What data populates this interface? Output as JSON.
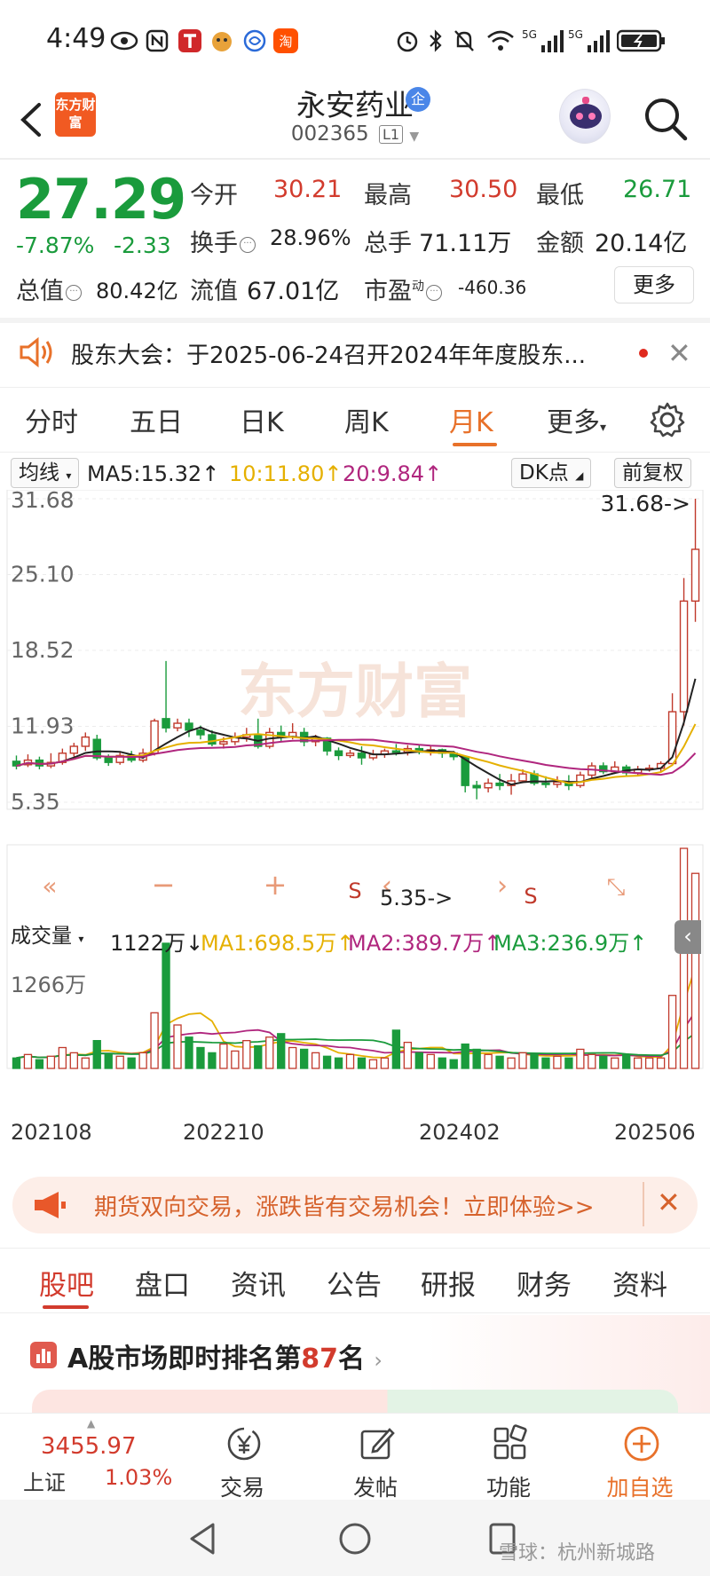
{
  "status_bar": {
    "time": "4:49",
    "network_badges": [
      "5G",
      "5G"
    ]
  },
  "header": {
    "stock_name": "永安药业",
    "badge": "企",
    "stock_code": "002365",
    "code_tag": "L1",
    "brand": "东方财富"
  },
  "quote": {
    "price": "27.29",
    "change_pct": "-7.87%",
    "change": "-2.33",
    "open_label": "今开",
    "open": "30.21",
    "high_label": "最高",
    "high": "30.50",
    "low_label": "最低",
    "low": "26.71",
    "turnover_label": "换手",
    "turnover": "28.96%",
    "volume_label": "总手",
    "volume": "71.11万",
    "amount_label": "金额",
    "amount": "20.14亿",
    "mktcap_label": "总值",
    "mktcap": "80.42亿",
    "float_label": "流值",
    "float_cap": "67.01亿",
    "pe_label": "市盈",
    "pe_sup": "动",
    "pe": "-460.36",
    "more": "更多"
  },
  "notice": {
    "text": "股东大会：于2025-06-24召开2024年年度股东..."
  },
  "tabs": [
    "分时",
    "五日",
    "日K",
    "周K",
    "月K",
    "更多"
  ],
  "active_tab": 4,
  "ma_row": {
    "selector": "均线",
    "ma5": "MA5:15.32↑",
    "ma10": "10:11.80↑",
    "ma20": "20:9.84↑",
    "dk": "DK点",
    "fq": "前复权"
  },
  "chart": {
    "y_ticks": [
      "31.68",
      "25.10",
      "18.52",
      "11.93",
      "5.35"
    ],
    "max_label": "31.68->",
    "min_label": "5.35->",
    "watermark": "东方财富",
    "s_marks": [
      "S",
      "S"
    ]
  },
  "volume_row": {
    "selector": "成交量",
    "value": "1122万↓",
    "ma1": "MA1:698.5万↑",
    "ma2": "MA2:389.7万↑",
    "ma3": "MA3:236.9万↑",
    "max_tick": "1266万"
  },
  "x_labels": [
    "202108",
    "202210",
    "202402",
    "202506"
  ],
  "chart_data": {
    "type": "candlestick",
    "y_range": [
      5.35,
      31.68
    ],
    "x_labels": [
      "202108",
      "202210",
      "202402",
      "202506"
    ],
    "candles": [
      {
        "o": 8.9,
        "c": 8.5,
        "h": 9.4,
        "l": 8.2
      },
      {
        "o": 8.6,
        "c": 9.0,
        "h": 9.5,
        "l": 8.4
      },
      {
        "o": 9.0,
        "c": 8.5,
        "h": 9.3,
        "l": 8.2
      },
      {
        "o": 8.5,
        "c": 8.8,
        "h": 9.6,
        "l": 8.3
      },
      {
        "o": 8.8,
        "c": 9.6,
        "h": 10.0,
        "l": 8.6
      },
      {
        "o": 9.6,
        "c": 10.2,
        "h": 10.5,
        "l": 9.3
      },
      {
        "o": 10.2,
        "c": 11.0,
        "h": 11.4,
        "l": 9.8
      },
      {
        "o": 10.8,
        "c": 9.2,
        "h": 11.2,
        "l": 9.0
      },
      {
        "o": 9.2,
        "c": 8.8,
        "h": 9.5,
        "l": 8.5
      },
      {
        "o": 8.8,
        "c": 9.4,
        "h": 9.7,
        "l": 8.6
      },
      {
        "o": 9.4,
        "c": 9.0,
        "h": 9.8,
        "l": 8.8
      },
      {
        "o": 9.0,
        "c": 9.6,
        "h": 10.0,
        "l": 8.8
      },
      {
        "o": 9.6,
        "c": 12.4,
        "h": 12.6,
        "l": 9.4
      },
      {
        "o": 12.6,
        "c": 11.8,
        "h": 17.6,
        "l": 11.4
      },
      {
        "o": 11.8,
        "c": 12.2,
        "h": 12.6,
        "l": 11.5
      },
      {
        "o": 12.2,
        "c": 11.6,
        "h": 12.6,
        "l": 11.0
      },
      {
        "o": 11.6,
        "c": 11.2,
        "h": 12.0,
        "l": 10.8
      },
      {
        "o": 11.2,
        "c": 10.4,
        "h": 11.6,
        "l": 10.2
      },
      {
        "o": 10.4,
        "c": 10.6,
        "h": 11.0,
        "l": 10.0
      },
      {
        "o": 10.6,
        "c": 11.0,
        "h": 11.4,
        "l": 10.3
      },
      {
        "o": 11.0,
        "c": 11.2,
        "h": 11.8,
        "l": 10.6
      },
      {
        "o": 11.2,
        "c": 10.2,
        "h": 12.6,
        "l": 10.0
      },
      {
        "o": 10.2,
        "c": 11.4,
        "h": 11.8,
        "l": 10.0
      },
      {
        "o": 11.4,
        "c": 11.0,
        "h": 12.0,
        "l": 10.6
      },
      {
        "o": 11.0,
        "c": 11.4,
        "h": 12.2,
        "l": 10.8
      },
      {
        "o": 11.4,
        "c": 10.6,
        "h": 11.8,
        "l": 10.2
      },
      {
        "o": 10.6,
        "c": 10.9,
        "h": 11.2,
        "l": 10.2
      },
      {
        "o": 10.9,
        "c": 9.8,
        "h": 11.0,
        "l": 9.4
      },
      {
        "o": 9.8,
        "c": 9.4,
        "h": 10.1,
        "l": 9.0
      },
      {
        "o": 9.4,
        "c": 9.6,
        "h": 9.9,
        "l": 9.2
      },
      {
        "o": 9.6,
        "c": 9.2,
        "h": 10.2,
        "l": 8.6
      },
      {
        "o": 9.2,
        "c": 9.5,
        "h": 9.9,
        "l": 9.0
      },
      {
        "o": 9.5,
        "c": 9.8,
        "h": 10.0,
        "l": 9.2
      },
      {
        "o": 9.8,
        "c": 9.7,
        "h": 10.4,
        "l": 9.4
      },
      {
        "o": 9.7,
        "c": 10.0,
        "h": 10.3,
        "l": 9.4
      },
      {
        "o": 10.0,
        "c": 9.7,
        "h": 10.3,
        "l": 9.5
      },
      {
        "o": 9.7,
        "c": 9.9,
        "h": 10.2,
        "l": 9.4
      },
      {
        "o": 9.9,
        "c": 9.6,
        "h": 10.0,
        "l": 9.2
      },
      {
        "o": 9.6,
        "c": 9.3,
        "h": 9.8,
        "l": 9.0
      },
      {
        "o": 9.3,
        "c": 6.8,
        "h": 9.4,
        "l": 6.2
      },
      {
        "o": 6.8,
        "c": 6.6,
        "h": 7.2,
        "l": 5.6
      },
      {
        "o": 6.6,
        "c": 7.0,
        "h": 7.4,
        "l": 6.2
      },
      {
        "o": 7.0,
        "c": 6.8,
        "h": 7.8,
        "l": 6.4
      },
      {
        "o": 6.8,
        "c": 7.2,
        "h": 7.8,
        "l": 6.0
      },
      {
        "o": 7.2,
        "c": 7.8,
        "h": 8.2,
        "l": 7.0
      },
      {
        "o": 7.8,
        "c": 7.0,
        "h": 8.1,
        "l": 6.8
      },
      {
        "o": 7.0,
        "c": 6.9,
        "h": 7.6,
        "l": 6.6
      },
      {
        "o": 6.9,
        "c": 7.1,
        "h": 7.6,
        "l": 6.6
      },
      {
        "o": 7.1,
        "c": 6.8,
        "h": 7.7,
        "l": 6.4
      },
      {
        "o": 6.8,
        "c": 7.7,
        "h": 8.0,
        "l": 6.6
      },
      {
        "o": 7.7,
        "c": 8.5,
        "h": 8.8,
        "l": 7.4
      },
      {
        "o": 8.5,
        "c": 8.0,
        "h": 8.8,
        "l": 7.8
      },
      {
        "o": 8.0,
        "c": 8.4,
        "h": 8.9,
        "l": 7.8
      },
      {
        "o": 8.4,
        "c": 7.9,
        "h": 8.6,
        "l": 7.6
      },
      {
        "o": 7.9,
        "c": 8.2,
        "h": 8.5,
        "l": 7.7
      },
      {
        "o": 8.2,
        "c": 8.3,
        "h": 8.6,
        "l": 8.0
      },
      {
        "o": 8.3,
        "c": 8.7,
        "h": 8.9,
        "l": 8.0
      },
      {
        "o": 8.7,
        "c": 13.2,
        "h": 14.8,
        "l": 8.5
      },
      {
        "o": 13.2,
        "c": 22.8,
        "h": 24.8,
        "l": 12.0
      },
      {
        "o": 22.8,
        "c": 27.29,
        "h": 31.68,
        "l": 21.0
      }
    ],
    "volume": [
      60,
      80,
      50,
      70,
      120,
      90,
      60,
      160,
      80,
      70,
      60,
      90,
      320,
      720,
      250,
      180,
      120,
      90,
      140,
      100,
      160,
      130,
      180,
      200,
      120,
      110,
      90,
      70,
      60,
      80,
      60,
      50,
      60,
      220,
      150,
      90,
      80,
      60,
      50,
      140,
      110,
      80,
      70,
      60,
      90,
      80,
      60,
      70,
      60,
      110,
      80,
      70,
      60,
      80,
      60,
      60,
      60,
      420,
      1266,
      1122
    ],
    "ma_price": {
      "ma5_color": "#222222",
      "ma10_color": "#e5b000",
      "ma20_color": "#b0267e"
    },
    "ma_volume": {
      "ma1_color": "#e5b000",
      "ma2_color": "#b0267e",
      "ma3_color": "#1a9b3c"
    }
  },
  "ad": {
    "text": "期货双向交易，涨跌皆有交易机会！立即体验>>"
  },
  "subtabs": [
    "股吧",
    "盘口",
    "资讯",
    "公告",
    "研报",
    "财务",
    "资料"
  ],
  "active_subtab": 0,
  "rank": {
    "prefix": "A股市场即时排名第",
    "num": "87",
    "suffix": "名"
  },
  "toolbar": {
    "index_value": "3455.97",
    "index_name": "上证",
    "index_pct": "1.03%",
    "trade": "交易",
    "post": "发帖",
    "functions": "功能",
    "add_watch": "加自选"
  },
  "watermark": "雪球：杭州新城路"
}
